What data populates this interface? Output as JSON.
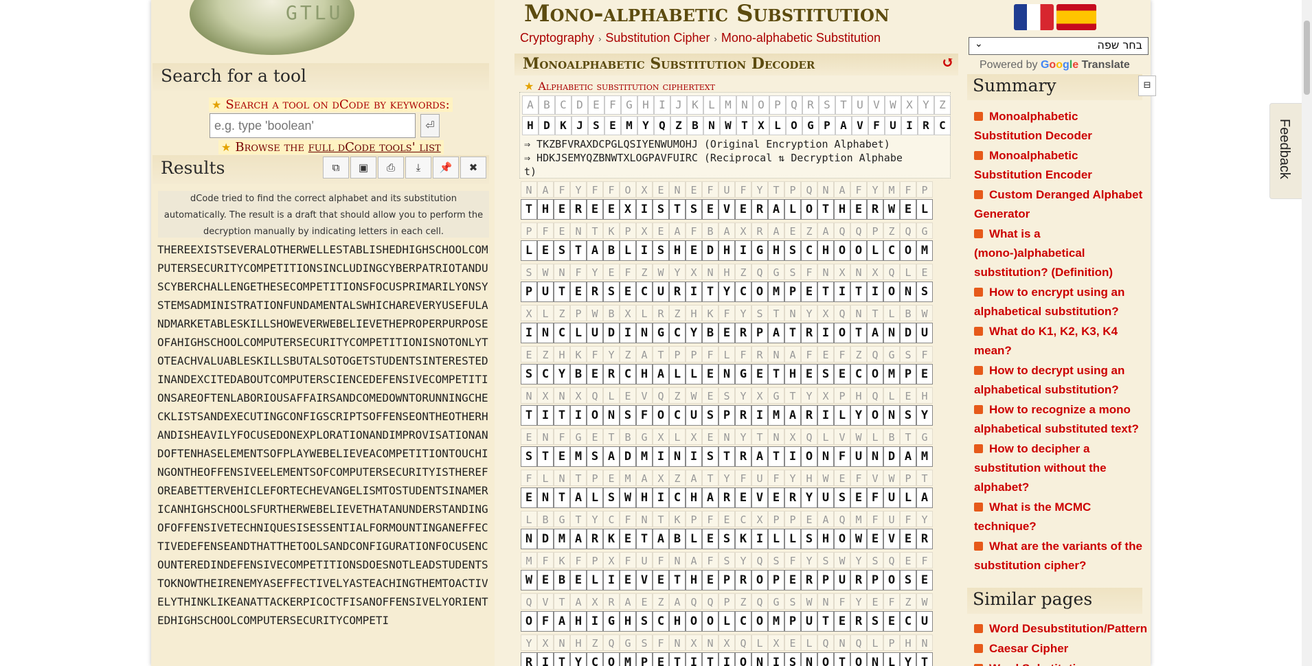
{
  "left": {
    "logo_text": "GTLU",
    "search_title": "Search for a tool",
    "search_keywords_label": "Search a tool on dCode by keywords:",
    "search_placeholder": "e.g. type 'boolean'",
    "browse_prefix": "Browse the",
    "browse_link": "full dCode tools' list",
    "results_title": "Results",
    "results_note": "dCode tried to find the correct alphabet and its substitution automatically. The result is a draft that should allow you to perform the decryption manually by indicating letters in each cell.",
    "plaintext": "THEREEXISTSEVERALOTHERWELLESTABLISHEDHIGHSCHOOLCOMPUTERSECURITYCOMPETITIONSINCLUDINGCYBERPATRIOTANDUSCYBERCHALLENGETHESECOMPETITIONSFOCUSPRIMARILYONSYSTEMSADMINISTRATIONFUNDAMENTALSWHICHAREVERYUSEFULANDMARKETABLESKILLSHOWEVERWEBELIEVETHEPROPERPURPOSEOFAHIGHSCHOOLCOMPUTERSECURITYCOMPETITIONISNOTONLYTOTEACHVALUABLESKILLSBUTALSOTOGETSTUDENTSINTERESTEDINANDEXCITEDABOUTCOMPUTERSCIENCEDEFENSIVECOMPETITIONSAREOFTENLABORIOUSAFFAIRSANDCOMEDOWNTORUNNINGCHECKLISTSANDEXECUTINGCONFIGSCRIPTSOFFENSEONTHEOTHERHANDISHEAVILYFOCUSEDONEXPLORATIONANDIMPROVISATIONANDOFTENHASELEMENTSOFPLAYWEBELIEVEACOMPETITIONTOUCHINGONTHEOFFENSIVEELEMENTSOFCOMPUTERSECURITYISTHEREFOREABETTERVEHICLEFORTECHEVANGELISMTOSTUDENTSINAMERICANHIGHSCHOOLSFURTHERWEBELIEVETHATANUNDERSTANDINGOFOFFENSIVETECHNIQUESISESSENTIALFORMOUNTINGANEFFECTIVEDEFENSEANDTHATTHETOOLSANDCONFIGURATIONFOCUSENCOUNTEREDINDEFENSIVECOMPETITIONSDOESNOTLEADSTUDENTSTOKNOWTHEIRENEMYASEFFECTIVELYASTEACHINGTHEMTOACTIVELYTHINKLIKEANATTACKERPICOCTFISANOFFENSIVELYORIENTEDHIGHSCHOOLCOMPUTERSECURITYCOMPETI"
  },
  "main": {
    "title": "Mono-alphabetic Substitution",
    "breadcrumbs": [
      "Cryptography",
      "Substitution Cipher",
      "Mono-alphabetic Substitution"
    ],
    "tool_title": "Monoalphabetic Substitution Decoder",
    "alphabet_label": "Alphabetic substitution ciphertext",
    "plain_alphabet": [
      "A",
      "B",
      "C",
      "D",
      "E",
      "F",
      "G",
      "H",
      "I",
      "J",
      "K",
      "L",
      "M",
      "N",
      "O",
      "P",
      "Q",
      "R",
      "S",
      "T",
      "U",
      "V",
      "W",
      "X",
      "Y",
      "Z"
    ],
    "cipher_alphabet": [
      "H",
      "D",
      "K",
      "J",
      "S",
      "E",
      "M",
      "Y",
      "Q",
      "Z",
      "B",
      "N",
      "W",
      "T",
      "X",
      "L",
      "O",
      "G",
      "P",
      "A",
      "V",
      "F",
      "U",
      "I",
      "R",
      "C"
    ],
    "map_line_1": "⇒ TKZBFVRAXDCPGLQSIYENWUMOHJ (Original Encryption Alphabet)",
    "map_line_2": "⇒ HDKJSEMYQZBNWTXLOGPAVFUIRC (Reciprocal ⇅ Decryption Alphabe",
    "map_line_3": "t)",
    "grid_rows": [
      {
        "cipher": "NAFYFFOXENEFUFYTPQNAFYMFP",
        "plain": "THEREEXISTSEVERALOTHERWEL"
      },
      {
        "cipher": "PFENTKPXEAFBAXRAEZAQQPZQG",
        "plain": "LESTABLISHEDHIGHSCHOOLCOM"
      },
      {
        "cipher": "SWNFYEFZWYXNHZQGSFNXNXQLE",
        "plain": "PUTERSECURITYCOMPETITIONS"
      },
      {
        "cipher": "XLZPWBXLRZHKFYSTNYXQNTLBW",
        "plain": "INCLUDINGCYBERPATRIOTANDU"
      },
      {
        "cipher": "EZHKFYZATPPFLFRNAFEFZQGSF",
        "plain": "SCYBERCHALLENGETHESECOMPE"
      },
      {
        "cipher": "NXNXQLEVQZWESYXGTYXPHQLEH",
        "plain": "TITIONSFOCUSPRIMARILYONSY"
      },
      {
        "cipher": "ENFGETBGXLXENYTNXQLVWLBTG",
        "plain": "STEMSADMINISTRATIONFUNDAM"
      },
      {
        "cipher": "FLNTPEMAXZATYFUFYHWEFVWPT",
        "plain": "ENTALSWHICHAREVERYUSEFULA"
      },
      {
        "cipher": "LBGTYCFNTKPFECXPPEAQMFUFY",
        "plain": "NDMARKETABLESKILLSHOWEVER"
      },
      {
        "cipher": "MFKFPXFUFNAFSYQSFYSWYSQEF",
        "plain": "WEBELIEVETHEPROPERPURPOSE"
      },
      {
        "cipher": "QVTAXRAEZAQQPZQGSWNFYEFZW",
        "plain": "OFAHIGHSCHOOLCOMPUTERSECU"
      },
      {
        "cipher": "YXNHZQGSFNXNXQLXELQNQLPHN",
        "plain": "RITYCOMPETITIONISNOTONLYT"
      }
    ]
  },
  "right": {
    "language_select": "בחר שפה",
    "powered_by": "Powered by",
    "google": "Google",
    "translate": "Translate",
    "summary_title": "Summary",
    "summary_items": [
      "Monoalphabetic Substitution Decoder",
      "Monoalphabetic Substitution Encoder",
      "Custom Deranged Alphabet Generator",
      "What is a (mono-)alphabetical substitution? (Definition)",
      "How to encrypt using an alphabetical substitution?",
      "What do K1, K2, K3, K4 mean?",
      "How to decrypt using an alphabetical substitution?",
      "How to recognize a mono alphabetical substituted text?",
      "How to decipher a substitution without the alphabet?",
      "What is the MCMC technique?",
      "What are the variants of the substitution cipher?"
    ],
    "similar_title": "Similar pages",
    "similar_items": [
      "Word Desubstitution/Pattern",
      "Caesar Cipher",
      "Word Substitution"
    ]
  },
  "feedback": "Feedback",
  "colors": {
    "accent_red": "#cc0000",
    "title_brown": "#5c4b0f",
    "page_bg": "#f7f0dc"
  }
}
